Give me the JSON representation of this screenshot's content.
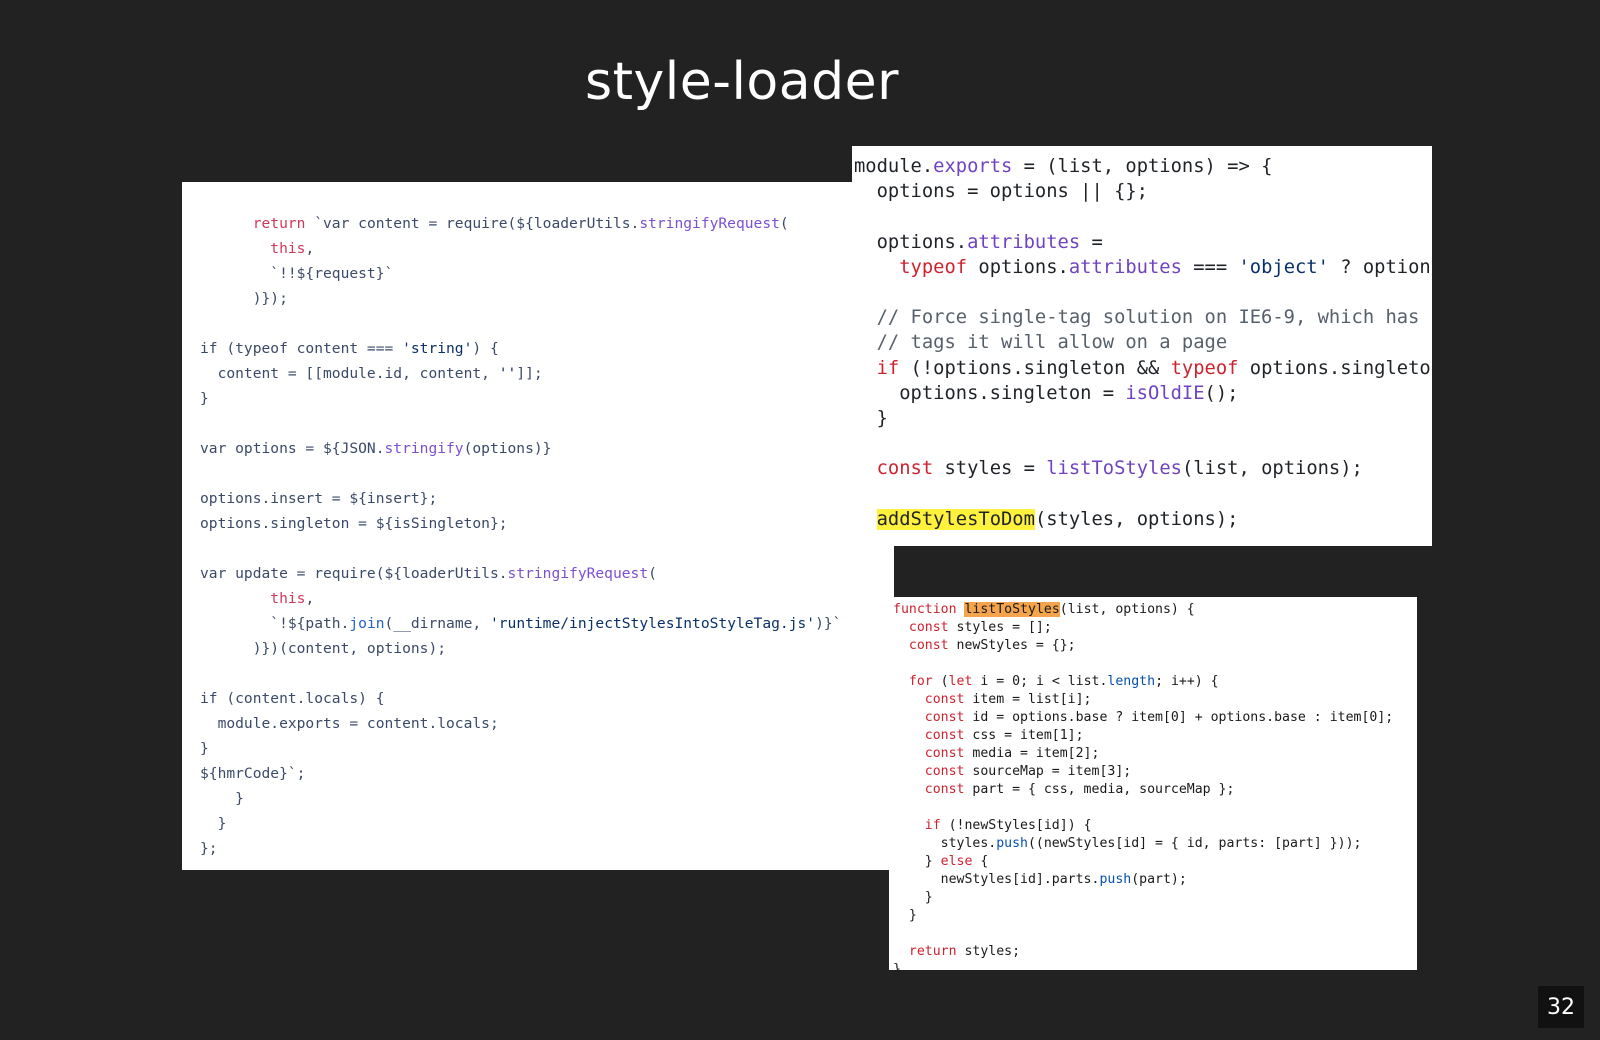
{
  "slide": {
    "title": "style-loader",
    "page_number": "32"
  },
  "left_code": {
    "lines": [
      "      return `var content = require(${loaderUtils.stringifyRequest(",
      "        this,",
      "        `!!${request}`",
      "      )});",
      "",
      "if (typeof content === 'string') {",
      "  content = [[module.id, content, '']];",
      "}",
      "",
      "var options = ${JSON.stringify(options)}",
      "",
      "options.insert = ${insert};",
      "options.singleton = ${isSingleton};",
      "",
      "var update = require(${loaderUtils.stringifyRequest(",
      "        this,",
      "        `!${path.join(__dirname, 'runtime/injectStylesIntoStyleTag.js')}`",
      "      )})(content, options);",
      "",
      "if (content.locals) {",
      "  module.exports = content.locals;",
      "}",
      "${hmrCode}`;",
      "    }",
      "  }",
      "};"
    ]
  },
  "right_top_code": {
    "lines": [
      "module.exports = (list, options) => {",
      "  options = options || {};",
      "",
      "  options.attributes =",
      "    typeof options.attributes === 'object' ? option",
      "",
      "  // Force single-tag solution on IE6-9, which has",
      "  // tags it will allow on a page",
      "  if (!options.singleton && typeof options.singleto",
      "    options.singleton = isOldIE();",
      "  }",
      "",
      "  const styles = listToStyles(list, options);",
      "",
      "  addStylesToDom(styles, options);"
    ],
    "highlighted": "addStylesToDom"
  },
  "bottom_code": {
    "lines": [
      "function listToStyles(list, options) {",
      "  const styles = [];",
      "  const newStyles = {};",
      "",
      "  for (let i = 0; i < list.length; i++) {",
      "    const item = list[i];",
      "    const id = options.base ? item[0] + options.base : item[0];",
      "    const css = item[1];",
      "    const media = item[2];",
      "    const sourceMap = item[3];",
      "    const part = { css, media, sourceMap };",
      "",
      "    if (!newStyles[id]) {",
      "      styles.push((newStyles[id] = { id, parts: [part] }));",
      "    } else {",
      "      newStyles[id].parts.push(part);",
      "    }",
      "  }",
      "",
      "  return styles;",
      "}"
    ],
    "highlighted": "listToStyles"
  },
  "colors": {
    "background": "#222222",
    "code_panel": "#ffffff",
    "highlight_yellow": "#fff13c",
    "highlight_orange": "#f4a44a"
  }
}
